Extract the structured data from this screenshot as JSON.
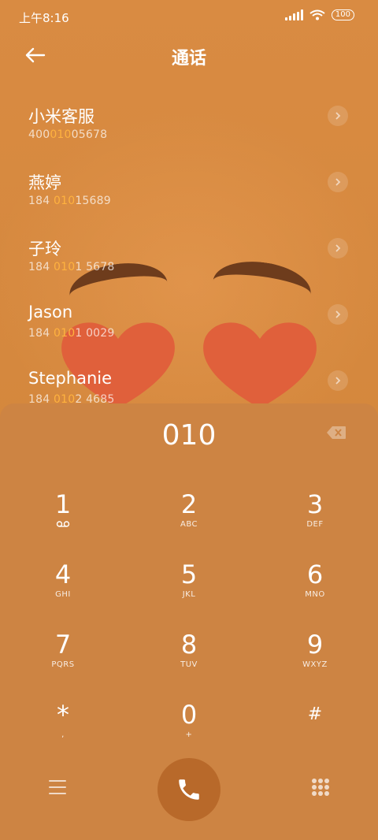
{
  "status_bar": {
    "time": "上午8:16",
    "battery": "100"
  },
  "header": {
    "title": "通话"
  },
  "results": [
    {
      "name": "小米客服",
      "number_prefix": "400",
      "number_match": "010",
      "number_suffix": "05678"
    },
    {
      "name": "燕婷",
      "number_prefix": "184 ",
      "number_match": "010",
      "number_suffix": "15689"
    },
    {
      "name": "子玲",
      "number_prefix": "184 ",
      "number_match": "010",
      "number_suffix": "1 5678"
    },
    {
      "name": "Jason",
      "number_prefix": "184 ",
      "number_match": "010",
      "number_suffix": "1 0029"
    },
    {
      "name": "Stephanie",
      "number_prefix": "184 ",
      "number_match": "010",
      "number_suffix": "2 4685"
    }
  ],
  "dialpad": {
    "input": "010",
    "keys": [
      {
        "digit": "1",
        "letters": "voicemail"
      },
      {
        "digit": "2",
        "letters": "ABC"
      },
      {
        "digit": "3",
        "letters": "DEF"
      },
      {
        "digit": "4",
        "letters": "GHI"
      },
      {
        "digit": "5",
        "letters": "JKL"
      },
      {
        "digit": "6",
        "letters": "MNO"
      },
      {
        "digit": "7",
        "letters": "PQRS"
      },
      {
        "digit": "8",
        "letters": "TUV"
      },
      {
        "digit": "9",
        "letters": "WXYZ"
      },
      {
        "digit": "*",
        "letters": ","
      },
      {
        "digit": "0",
        "letters": "+"
      },
      {
        "digit": "#",
        "letters": ""
      }
    ]
  },
  "icons": {
    "back": "back-arrow-icon",
    "delete": "backspace-icon",
    "call": "phone-icon",
    "menu": "menu-icon",
    "dialpad_toggle": "dialpad-icon"
  },
  "colors": {
    "background": "#D9893F",
    "highlight": "#FFB23F",
    "call_button": "#B8692A"
  }
}
